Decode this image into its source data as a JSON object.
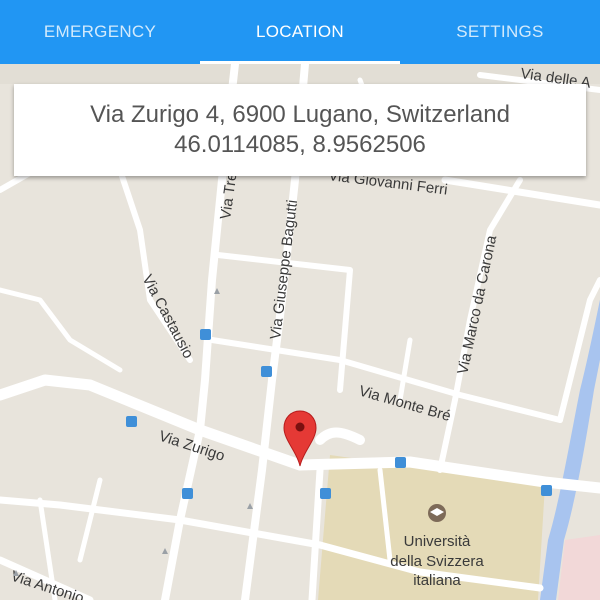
{
  "tabs": [
    {
      "label": "EMERGENCY"
    },
    {
      "label": "LOCATION"
    },
    {
      "label": "SETTINGS"
    }
  ],
  "active_tab": "LOCATION",
  "location": {
    "address": "Via Zurigo 4, 6900 Lugano, Switzerland",
    "coordinates": "46.0114085, 8.9562506"
  },
  "map": {
    "street_labels": {
      "via_delle_alpi": "Via delle A",
      "via_giovanni_ferri": "Via Giovanni Ferri",
      "via_tre": "Via Tre",
      "via_giuseppe_bagutti": "Via Giuseppe Bagutti",
      "via_marco_da_carona": "Via Marco da Carona",
      "via_castausio": "Via Castausio",
      "via_monte_bre": "Via Monte Bré",
      "via_zurigo": "Via Zurigo",
      "via_antonio": "Via Antonio"
    },
    "poi": {
      "university_line1": "Università",
      "university_line2": "della Svizzera",
      "university_line3": "italiana"
    }
  },
  "colors": {
    "accent": "#2196f3",
    "map_background": "#e8e4dc",
    "road": "#ffffff",
    "university_area": "#e4dab7",
    "river": "#a8c4ef",
    "marker": "#e53935"
  }
}
